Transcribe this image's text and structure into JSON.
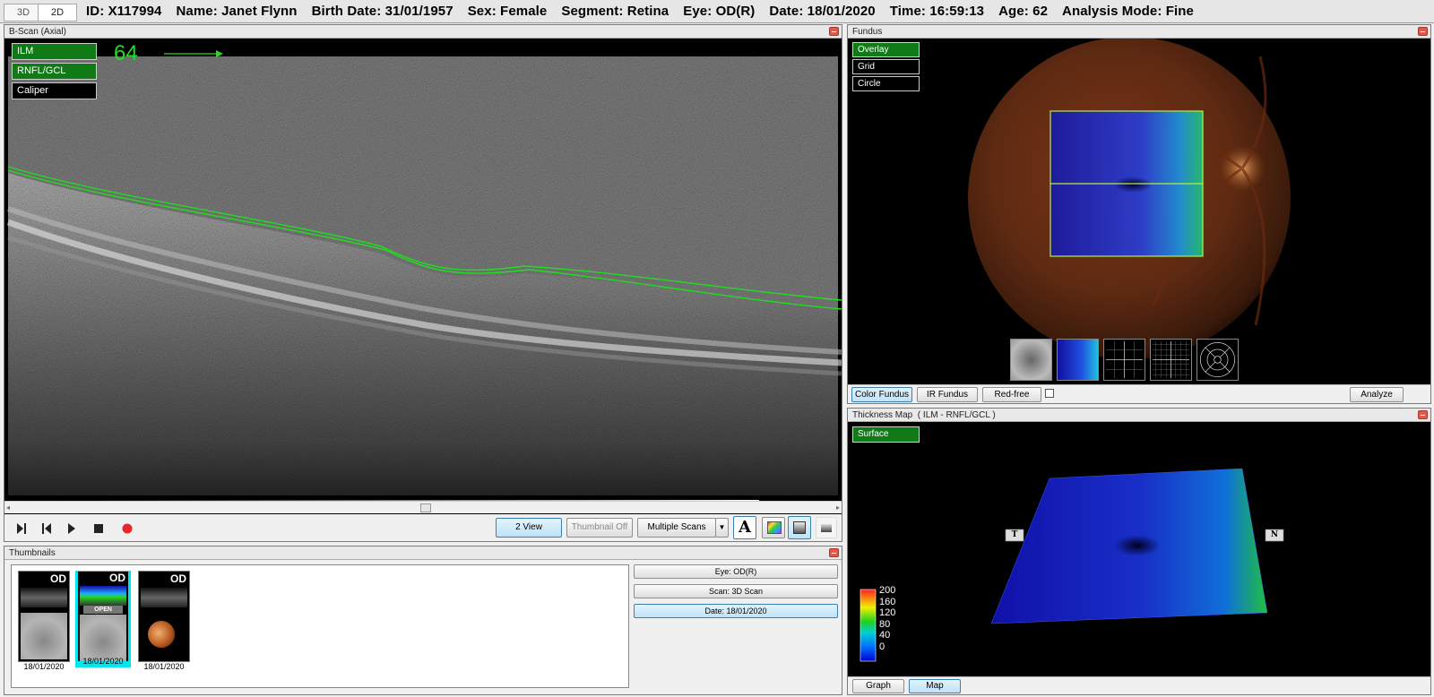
{
  "header": {
    "tabs": [
      "3D",
      "2D"
    ],
    "id": "ID: X117994",
    "name": "Name: Janet Flynn",
    "birth_date": "Birth Date: 31/01/1957",
    "sex": "Sex: Female",
    "segment": "Segment: Retina",
    "eye": "Eye: OD(R)",
    "date": "Date: 18/01/2020",
    "time": "Time: 16:59:13",
    "age": "Age: 62",
    "analysis_mode": "Analysis Mode: Fine"
  },
  "bscan": {
    "title": "B-Scan (Axial)",
    "layers": [
      "ILM",
      "RNFL/GCL",
      "Caliper"
    ],
    "slice_number": "64",
    "buttons": {
      "two_view": "2 View",
      "thumbnail_off": "Thumbnail Off",
      "multiple_scans": "Multiple Scans"
    },
    "colors": {
      "segmentation": "#22dd22",
      "record": "#e8262c"
    }
  },
  "fundus": {
    "title": "Fundus",
    "overlay_options": [
      "Overlay",
      "Grid",
      "Circle"
    ],
    "modes": [
      "Color Fundus",
      "IR Fundus",
      "Red-free"
    ],
    "analyze": "Analyze"
  },
  "thickness": {
    "title": "Thickness Map  ( ILM - RNFL/GCL )",
    "surface": "Surface",
    "temporal": "T",
    "nasal": "N",
    "scale_ticks": [
      "200",
      "160",
      "120",
      "80",
      "40",
      "0"
    ],
    "buttons": [
      "Graph",
      "Map"
    ]
  },
  "thumbnails": {
    "title": "Thumbnails",
    "items": [
      {
        "eye": "OD",
        "date": "18/01/2020",
        "badge": ""
      },
      {
        "eye": "OD",
        "date": "18/01/2020",
        "badge": "OPEN"
      },
      {
        "eye": "OD",
        "date": "18/01/2020",
        "badge": ""
      }
    ],
    "info_buttons": [
      "Eye: OD(R)",
      "Scan: 3D Scan",
      "Date: 18/01/2020"
    ]
  }
}
